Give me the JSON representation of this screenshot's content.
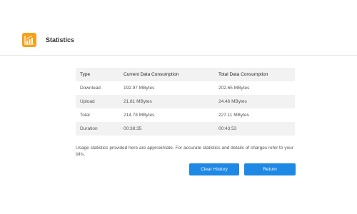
{
  "header": {
    "icon": "statistics-chart-icon",
    "title": "Statistics"
  },
  "table": {
    "headers": [
      "Type",
      "Current Data Consumption",
      "Total Data Consumption"
    ],
    "rows": [
      [
        "Download",
        "192.97 MBytes",
        "202.65 MBytes"
      ],
      [
        "Upload",
        "21.81 MBytes",
        "24.46 MBytes"
      ],
      [
        "Total",
        "214.78 MBytes",
        "227.11 MBytes"
      ],
      [
        "Duration",
        "00:38:35",
        "00:43:53"
      ]
    ]
  },
  "note": "Usage statistics provided here are approximate. For accurate statistics and details of charges refer to your bills.",
  "buttons": {
    "clear_history": "Clear History",
    "return": "Return"
  },
  "colors": {
    "accent": "#f7a11a",
    "button": "#1e88e5",
    "row_shade": "#f2f2f2"
  }
}
